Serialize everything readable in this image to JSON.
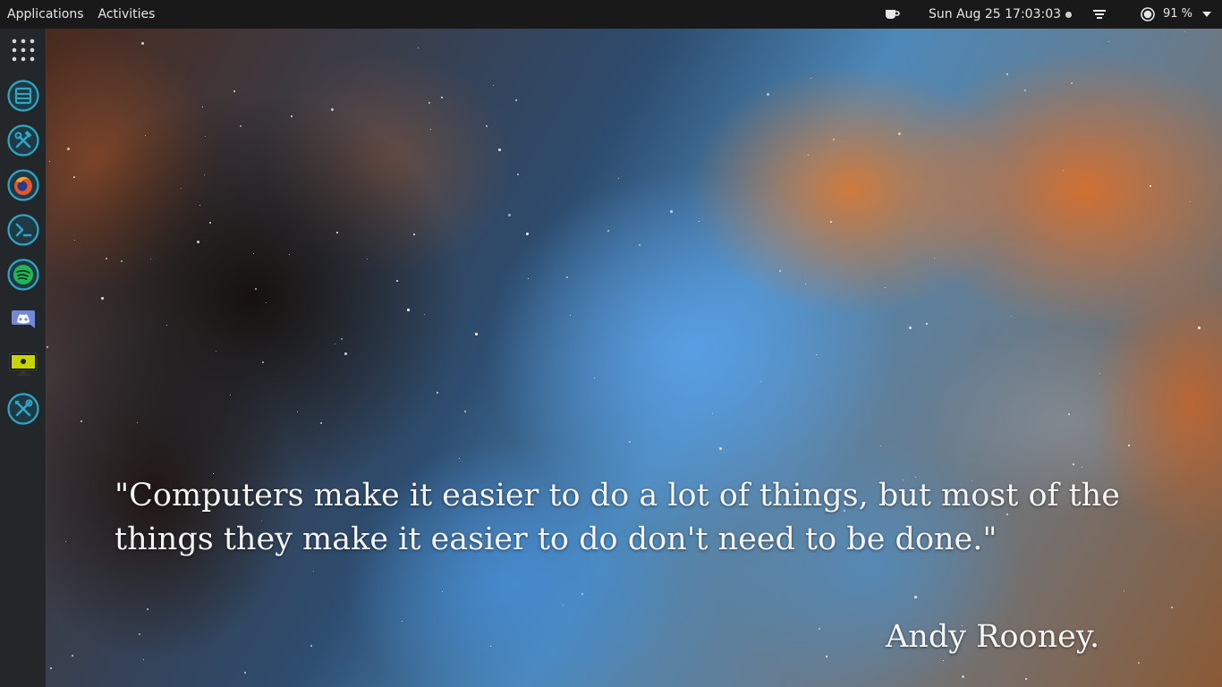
{
  "topbar": {
    "applications_label": "Applications",
    "activities_label": "Activities",
    "clock": "Sun Aug 25  17:03:03",
    "battery_percent": "91 %",
    "tray_icons": [
      "coffee-cup-icon",
      "wifi-icon",
      "night-light-icon",
      "battery-icon",
      "chevron-down-icon"
    ]
  },
  "dock": {
    "items": [
      {
        "name": "app-grid",
        "icon": "app-grid-icon"
      },
      {
        "name": "file-manager",
        "icon": "file-manager-icon"
      },
      {
        "name": "tools",
        "icon": "hammer-wrench-icon"
      },
      {
        "name": "firefox",
        "icon": "firefox-icon"
      },
      {
        "name": "terminal",
        "icon": "terminal-icon"
      },
      {
        "name": "spotify",
        "icon": "spotify-icon"
      },
      {
        "name": "discord",
        "icon": "discord-icon"
      },
      {
        "name": "display",
        "icon": "monitor-icon"
      },
      {
        "name": "settings",
        "icon": "settings-tools-icon"
      }
    ],
    "accent": "#2fa6c6"
  },
  "wallpaper": {
    "quote": "\"Computers make it easier to do a lot of things, but most of the\n things they make it easier to do don't need to be done.\"",
    "author": "Andy Rooney."
  }
}
